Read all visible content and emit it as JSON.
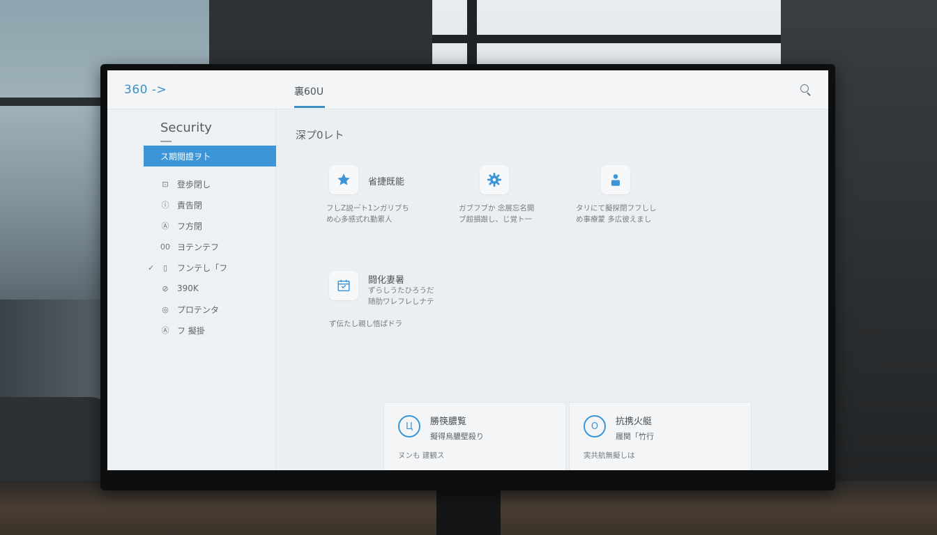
{
  "header": {
    "brand": "360 ->",
    "tab_label": "裏60U",
    "search_icon": "search-icon"
  },
  "sidebar": {
    "title": "Security",
    "items": [
      {
        "label": "ス期閲證ヲ卜",
        "icon": "",
        "active": true
      },
      {
        "label": "登歩閉し",
        "icon": "⊡"
      },
      {
        "label": "責告閉",
        "icon": "ⓘ"
      },
      {
        "label": "フ方閉",
        "icon": "Ⓐ"
      },
      {
        "label": "ヨテンテフ",
        "icon": "00"
      },
      {
        "label": "フンテし「フ",
        "icon": "▯",
        "checked": true
      },
      {
        "label": "390K",
        "icon": "⊘"
      },
      {
        "label": "プロテンタ",
        "icon": "◎"
      },
      {
        "label": "フ 擬掛",
        "icon": "Ⓐ"
      }
    ]
  },
  "main": {
    "section_title": "深プ0レト",
    "cards": [
      {
        "title": "省捷既能",
        "icon": "star-icon",
        "desc": [
          "フしZ説ー゙ト1ンガリブち",
          "め心多感式れ勤累人"
        ]
      },
      {
        "title": "",
        "icon": "gear-icon",
        "desc": [
          "ガブフブか 念展忘名開",
          "ブ超損跟し、じ覚ト一"
        ]
      },
      {
        "title": "",
        "icon": "user-icon",
        "desc": [
          "タリにて擬探閉フフしし",
          "め事療蒙 多広彼えまし"
        ]
      },
      {
        "title": "闘化妻暑",
        "icon": "calendar-icon",
        "desc": [
          "ずらしうたひろうだ",
          "随肋ワレフレしナテ"
        ],
        "footer": "ず伝たし親し悟ぱドラ"
      }
    ],
    "bottom_panels": [
      {
        "title": "勝筷膿覧",
        "subtitle": "擬得烏膿壁殺り",
        "footer": "ヌンも 建観ス",
        "icon": "shield-icon",
        "glyph": "Ц"
      },
      {
        "title": "抗携火艇",
        "subtitle": "履関「竹行",
        "footer": "実共航無擬しは",
        "icon": "power-icon",
        "glyph": "Ο"
      }
    ]
  },
  "colors": {
    "accent": "#3b95d6",
    "brand": "#3e8fc4"
  }
}
